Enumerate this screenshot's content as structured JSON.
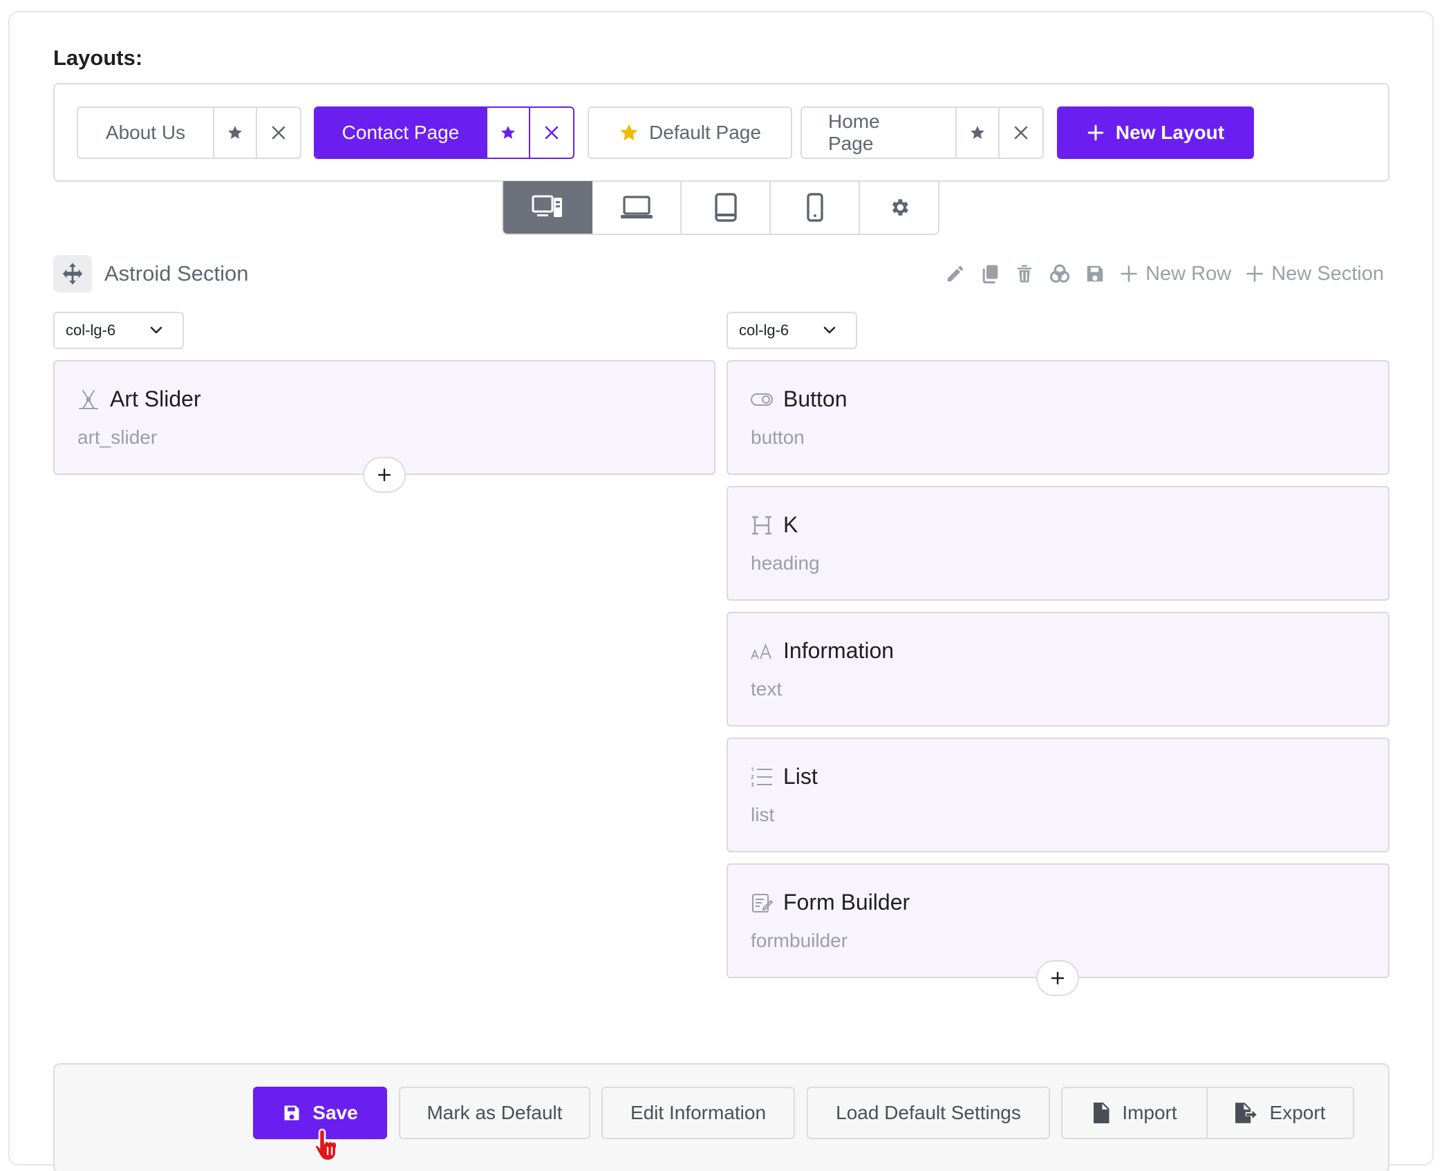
{
  "layouts_label": "Layouts:",
  "layouts": [
    {
      "name": "About Us",
      "active": false,
      "default": false
    },
    {
      "name": "Contact Page",
      "active": true,
      "default": false
    },
    {
      "name": "Default Page",
      "active": false,
      "default": true
    },
    {
      "name": "Home Page",
      "active": false,
      "default": false
    }
  ],
  "new_layout_label": "New Layout",
  "devices": [
    "desktop-icon",
    "laptop-icon",
    "tablet-icon",
    "mobile-icon",
    "gear-icon"
  ],
  "section": {
    "title": "Astroid Section",
    "new_row": "New Row",
    "new_section": "New Section"
  },
  "columns": [
    {
      "size": "col-lg-6",
      "elements": [
        {
          "title": "Art Slider",
          "type": "art_slider",
          "icon": "art-slider-icon"
        }
      ]
    },
    {
      "size": "col-lg-6",
      "elements": [
        {
          "title": "Button",
          "type": "button",
          "icon": "toggle-icon"
        },
        {
          "title": "K",
          "type": "heading",
          "icon": "heading-icon"
        },
        {
          "title": "Information",
          "type": "text",
          "icon": "text-size-icon"
        },
        {
          "title": "List",
          "type": "list",
          "icon": "list-ol-icon"
        },
        {
          "title": "Form Builder",
          "type": "formbuilder",
          "icon": "form-icon"
        }
      ]
    }
  ],
  "footer": {
    "save": "Save",
    "mark_default": "Mark as Default",
    "edit_info": "Edit Information",
    "load_defaults": "Load Default Settings",
    "import": "Import",
    "export": "Export"
  },
  "colors": {
    "accent": "#6a1ff0",
    "star_default": "#f5b800",
    "card_bg": "#f8f4fe"
  }
}
